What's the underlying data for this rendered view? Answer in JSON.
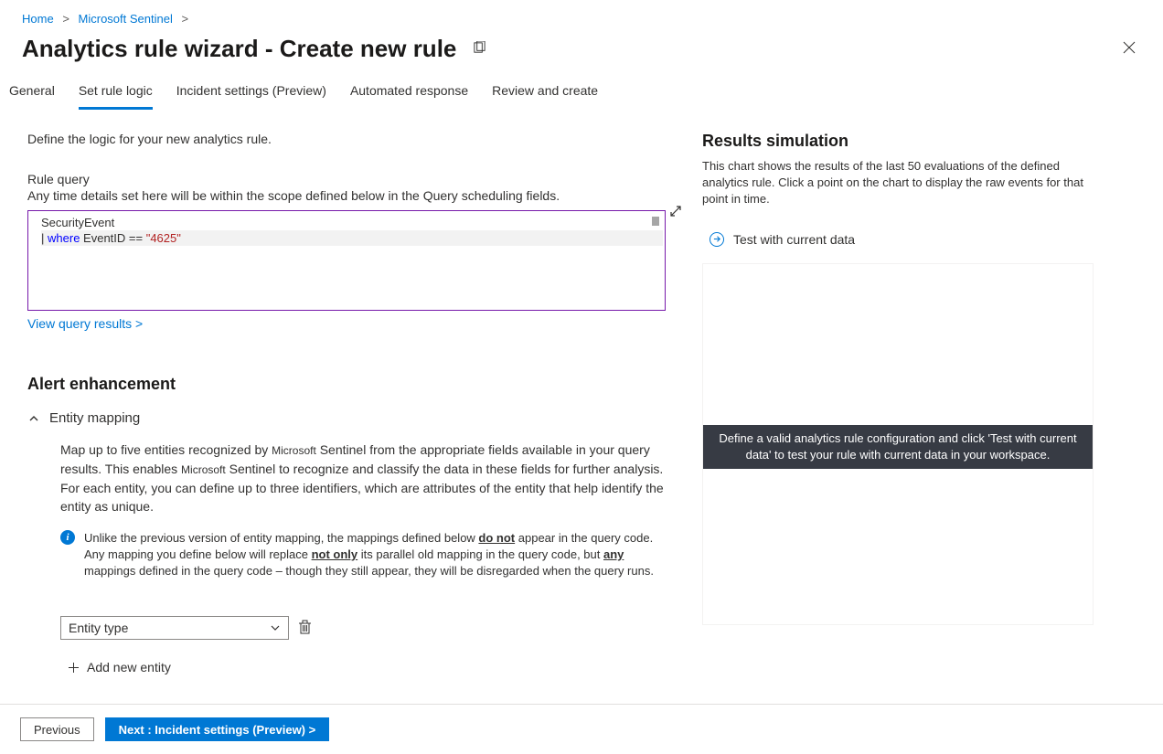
{
  "breadcrumb": {
    "home": "Home",
    "sentinel": "Microsoft Sentinel"
  },
  "page_title": "Analytics rule wizard - Create new rule",
  "tabs": {
    "general": "General",
    "set_rule_logic": "Set rule logic",
    "incident_settings": "Incident settings (Preview)",
    "automated_response": "Automated response",
    "review_create": "Review and create"
  },
  "intro": "Define the logic for your new analytics rule.",
  "rule_query": {
    "label": "Rule query",
    "help": "Any time details set here will be within the scope defined below in the Query scheduling fields.",
    "code_line1": "SecurityEvent",
    "code_pipe": "|",
    "code_where": "where",
    "code_mid": " EventID == ",
    "code_str": "\"4625\"",
    "view_results": "View query results  >"
  },
  "alert_enh_title": "Alert enhancement",
  "entity_mapping": {
    "label": "Entity mapping",
    "desc_pre": "Map up to five entities recognized by ",
    "desc_ms": "Microsoft",
    "desc_post": " Sentinel from the appropriate fields available in your query results. This enables ",
    "desc_ms2": "Microsoft",
    "desc_post2": " Sentinel to recognize and classify the data in these fields for further analysis. For each entity, you can define up to three identifiers, which are attributes of the entity that help identify the entity as unique.",
    "info_pre": "Unlike the previous version of entity mapping, the mappings defined below ",
    "info_do_not": "do not",
    "info_mid": " appear in the query code. Any mapping you define below will replace ",
    "info_not_only": "not only",
    "info_mid2": " its parallel old mapping in the query code, but ",
    "info_any": "any",
    "info_post": " mappings defined in the query code – though they still appear, they will be disregarded when the query runs.",
    "select_placeholder": "Entity type",
    "add_new": "Add new entity"
  },
  "results_sim": {
    "title": "Results simulation",
    "desc": "This chart shows the results of the last 50 evaluations of the defined analytics rule. Click a point on the chart to display the raw events for that point in time.",
    "test_link": "Test with current data",
    "banner": "Define a valid analytics rule configuration and click 'Test with current data' to test your rule with current data in your workspace."
  },
  "footer": {
    "previous": "Previous",
    "next": "Next : Incident settings (Preview)  >"
  }
}
